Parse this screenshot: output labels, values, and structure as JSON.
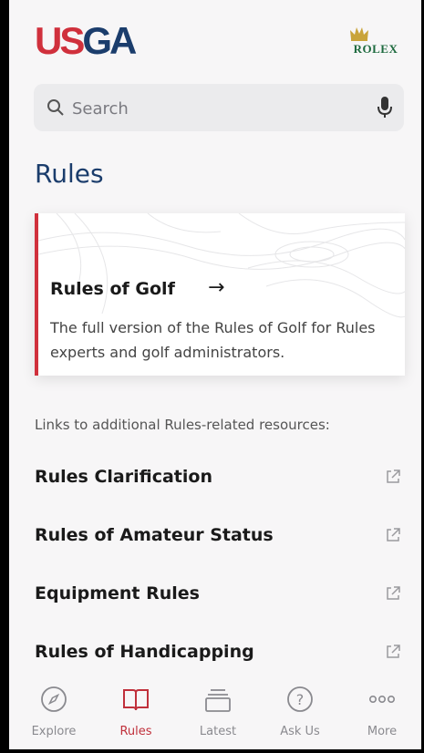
{
  "header": {
    "logo_left": "US",
    "logo_right": "GA",
    "sponsor": "ROLEX"
  },
  "search": {
    "placeholder": "Search",
    "value": ""
  },
  "page": {
    "title": "Rules"
  },
  "card": {
    "title": "Rules of Golf",
    "arrow": "→",
    "description": "The full version of the Rules of Golf for Rules experts and golf administrators."
  },
  "links": {
    "intro": "Links to additional Rules-related resources:",
    "items": [
      {
        "label": "Rules Clarification",
        "icon": "external-link-icon"
      },
      {
        "label": "Rules of Amateur Status",
        "icon": "external-link-icon"
      },
      {
        "label": "Equipment Rules",
        "icon": "external-link-icon"
      },
      {
        "label": "Rules of Handicapping",
        "icon": "external-link-icon"
      }
    ]
  },
  "tabs": [
    {
      "label": "Explore",
      "icon": "compass-icon",
      "active": false
    },
    {
      "label": "Rules",
      "icon": "book-icon",
      "active": true
    },
    {
      "label": "Latest",
      "icon": "stack-icon",
      "active": false
    },
    {
      "label": "Ask Us",
      "icon": "question-icon",
      "active": false
    },
    {
      "label": "More",
      "icon": "more-icon",
      "active": false
    }
  ],
  "colors": {
    "brand_red": "#d0303c",
    "brand_navy": "#1b3d6c",
    "rolex_green": "#1d6a3e",
    "tab_inactive": "#8a8a8f"
  }
}
